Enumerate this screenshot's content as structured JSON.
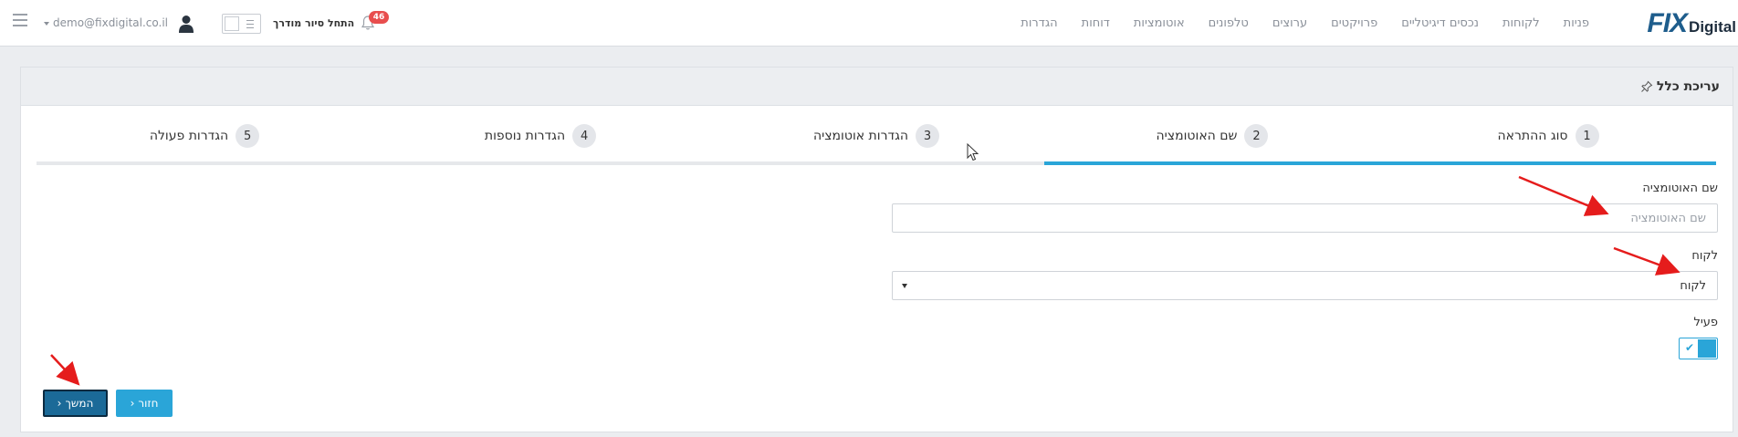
{
  "topbar": {
    "logo": {
      "fix": "FIX",
      "digital": "Digital"
    },
    "nav": [
      "פניות",
      "לקוחות",
      "נכסים דיגיטליים",
      "פרויקטים",
      "ערוצים",
      "טלפונים",
      "אוטומציות",
      "דוחות",
      "הגדרות"
    ],
    "user_email": "demo@fixdigital.co.il",
    "tour_label": "התחל סיור מודרך",
    "notifications_count": "46"
  },
  "panel": {
    "title": "עריכת כלל"
  },
  "steps": [
    {
      "num": "1",
      "label": "סוג ההתראה",
      "state": "done"
    },
    {
      "num": "2",
      "label": "שם האוטומציה",
      "state": "active"
    },
    {
      "num": "3",
      "label": "הגדרות אוטומציה",
      "state": "pending"
    },
    {
      "num": "4",
      "label": "הגדרות נוספות",
      "state": "pending"
    },
    {
      "num": "5",
      "label": "הגדרות פעולה",
      "state": "pending"
    }
  ],
  "form": {
    "automation_name": {
      "label": "שם האוטומציה",
      "placeholder": "שם האוטומציה",
      "value": ""
    },
    "customer": {
      "label": "לקוח",
      "selected": "לקוח"
    },
    "active": {
      "label": "פעיל",
      "checked": true
    }
  },
  "buttons": {
    "next": "המשך",
    "back": "חזור"
  },
  "colors": {
    "accent": "#2aa5d8",
    "next_button": "#1b6a98",
    "badge": "#e84e4e",
    "annotation": "#e51c1c"
  }
}
